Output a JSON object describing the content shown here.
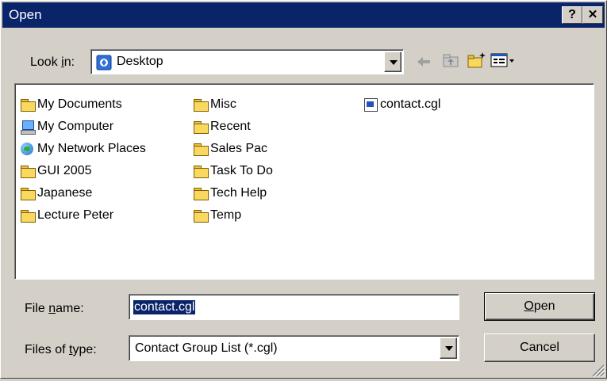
{
  "window": {
    "title": "Open",
    "help_label": "?",
    "close_label": "✕"
  },
  "lookin": {
    "label_pre": "Look ",
    "label_ul": "i",
    "label_post": "n:",
    "value": "Desktop"
  },
  "toolbar": {
    "back_icon": "back-arrow-icon",
    "up_icon": "up-folder-icon",
    "new_folder_icon": "new-folder-icon",
    "view_icon": "view-menu-icon"
  },
  "files": [
    {
      "name": "My Documents",
      "icon": "my-documents-icon"
    },
    {
      "name": "My Computer",
      "icon": "my-computer-icon"
    },
    {
      "name": "My Network Places",
      "icon": "network-places-icon"
    },
    {
      "name": "GUI 2005",
      "icon": "folder-icon"
    },
    {
      "name": "Japanese",
      "icon": "folder-icon"
    },
    {
      "name": "Lecture Peter",
      "icon": "folder-icon"
    },
    {
      "name": "Misc",
      "icon": "folder-icon"
    },
    {
      "name": "Recent",
      "icon": "folder-icon"
    },
    {
      "name": "Sales Pac",
      "icon": "folder-icon"
    },
    {
      "name": "Task To Do",
      "icon": "folder-icon"
    },
    {
      "name": "Tech Help",
      "icon": "folder-icon"
    },
    {
      "name": "Temp",
      "icon": "folder-icon"
    },
    {
      "name": "contact.cgl",
      "icon": "cgl-file-icon"
    }
  ],
  "filename": {
    "label_pre": "File ",
    "label_ul": "n",
    "label_post": "ame:",
    "value": "contact.cgl"
  },
  "filetype": {
    "label_pre": "Files of ",
    "label_ul": "t",
    "label_post": "ype:",
    "value": "Contact Group List (*.cgl)"
  },
  "buttons": {
    "open_ul": "O",
    "open_rest": "pen",
    "cancel": "Cancel"
  },
  "colors": {
    "titlebar": "#0a246a",
    "face": "#d4d0c8",
    "selection": "#0a246a"
  }
}
